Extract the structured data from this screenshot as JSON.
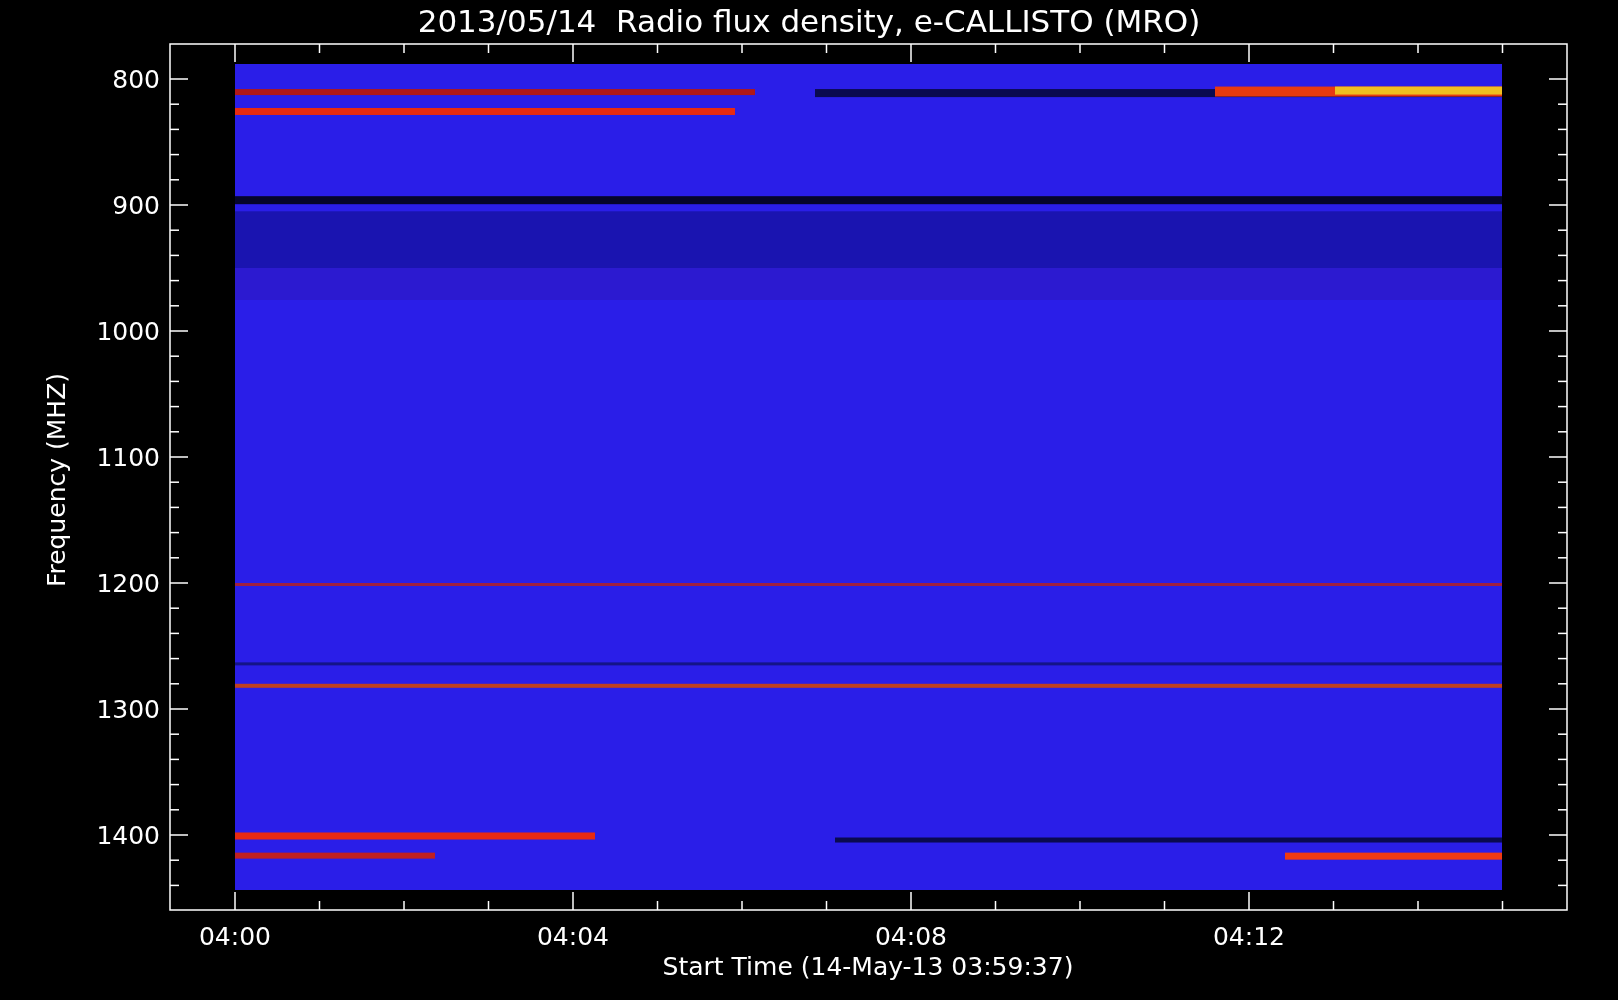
{
  "title": "2013/05/14  Radio flux density, e-CALLISTO (MRO)",
  "y_axis": {
    "label": "Frequency (MHZ)",
    "ticks": [
      "800",
      "900",
      "1000",
      "1100",
      "1200",
      "1300",
      "1400"
    ]
  },
  "x_axis": {
    "label": "Start Time (14-May-13 03:59:37)",
    "ticks": [
      "04:00",
      "04:04",
      "04:08",
      "04:12"
    ]
  }
}
